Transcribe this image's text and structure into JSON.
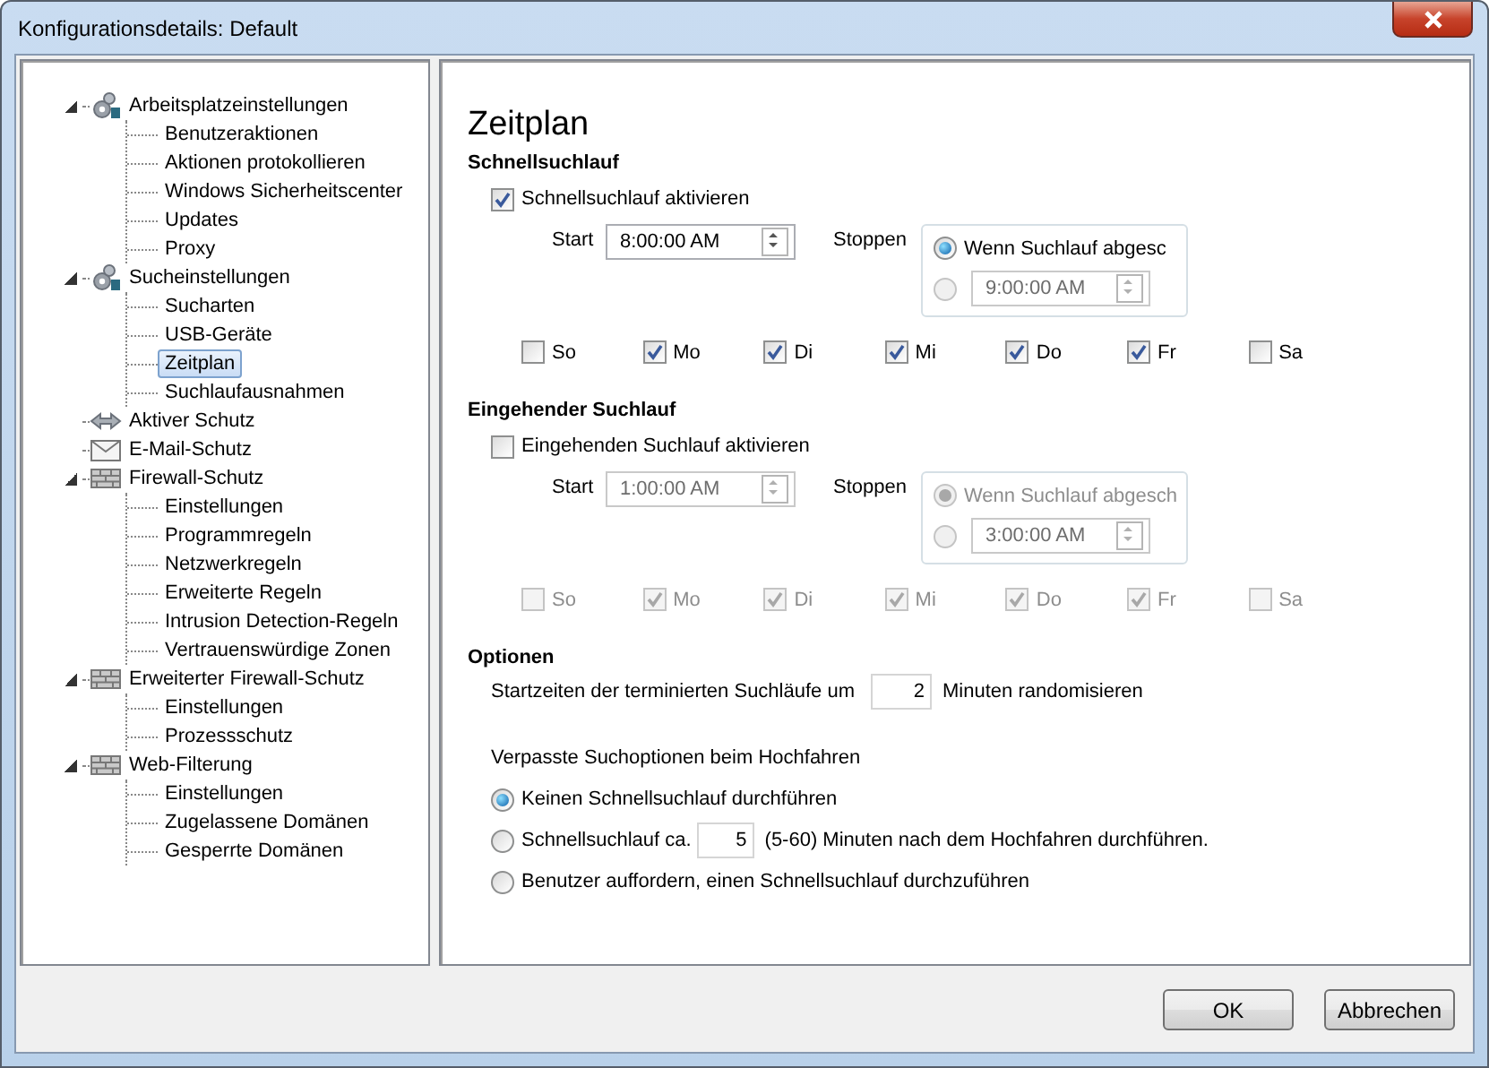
{
  "window": {
    "title": "Konfigurationsdetails: Default"
  },
  "tree": [
    {
      "label": "Arbeitsplatzeinstellungen",
      "kind": "gears",
      "expanded": true,
      "selected": false,
      "children": [
        {
          "label": "Benutzeraktionen",
          "selected": false
        },
        {
          "label": "Aktionen protokollieren",
          "selected": false
        },
        {
          "label": "Windows Sicherheitscenter",
          "selected": false
        },
        {
          "label": "Updates",
          "selected": false
        },
        {
          "label": "Proxy",
          "selected": false
        }
      ]
    },
    {
      "label": "Sucheinstellungen",
      "kind": "gears",
      "expanded": true,
      "selected": false,
      "children": [
        {
          "label": "Sucharten",
          "selected": false
        },
        {
          "label": "USB-Geräte",
          "selected": false
        },
        {
          "label": "Zeitplan",
          "selected": true
        },
        {
          "label": "Suchlaufausnahmen",
          "selected": false
        }
      ]
    },
    {
      "label": "Aktiver Schutz",
      "kind": "arrows",
      "expanded": false,
      "selected": false
    },
    {
      "label": "E-Mail-Schutz",
      "kind": "mail",
      "expanded": false,
      "selected": false
    },
    {
      "label": "Firewall-Schutz",
      "kind": "wall",
      "expanded": true,
      "selected": false,
      "children": [
        {
          "label": "Einstellungen",
          "selected": false
        },
        {
          "label": "Programmregeln",
          "selected": false
        },
        {
          "label": "Netzwerkregeln",
          "selected": false
        },
        {
          "label": "Erweiterte Regeln",
          "selected": false
        },
        {
          "label": "Intrusion Detection-Regeln",
          "selected": false
        },
        {
          "label": "Vertrauenswürdige Zonen",
          "selected": false
        }
      ]
    },
    {
      "label": "Erweiterter Firewall-Schutz",
      "kind": "wall",
      "expanded": true,
      "selected": false,
      "children": [
        {
          "label": "Einstellungen",
          "selected": false
        },
        {
          "label": "Prozessschutz",
          "selected": false
        }
      ]
    },
    {
      "label": "Web-Filterung",
      "kind": "wall",
      "expanded": true,
      "selected": false,
      "children": [
        {
          "label": "Einstellungen",
          "selected": false
        },
        {
          "label": "Zugelassene Domänen",
          "selected": false
        },
        {
          "label": "Gesperrte Domänen",
          "selected": false
        }
      ]
    }
  ],
  "page_title": "Zeitplan",
  "scans": [
    {
      "heading": "Schnellsuchlauf",
      "enable_label": "Schnellsuchlauf aktivieren",
      "enabled": true,
      "start_label": "Start",
      "start_time": "8:00:00 AM",
      "stop_label": "Stoppen",
      "stop_options": [
        {
          "kind": "label",
          "label": "Wenn Suchlauf abgesc",
          "selected": true
        },
        {
          "kind": "time",
          "value": "9:00:00 AM",
          "selected": false
        }
      ],
      "days": [
        {
          "label": "So",
          "checked": false
        },
        {
          "label": "Mo",
          "checked": true
        },
        {
          "label": "Di",
          "checked": true
        },
        {
          "label": "Mi",
          "checked": true
        },
        {
          "label": "Do",
          "checked": true
        },
        {
          "label": "Fr",
          "checked": true
        },
        {
          "label": "Sa",
          "checked": false
        }
      ]
    },
    {
      "heading": "Eingehender Suchlauf",
      "enable_label": "Eingehenden Suchlauf aktivieren",
      "enabled": false,
      "start_label": "Start",
      "start_time": "1:00:00 AM",
      "stop_label": "Stoppen",
      "stop_options": [
        {
          "kind": "label",
          "label": "Wenn Suchlauf abgesch",
          "selected": true
        },
        {
          "kind": "time",
          "value": "3:00:00 AM",
          "selected": false
        }
      ],
      "days": [
        {
          "label": "So",
          "checked": false
        },
        {
          "label": "Mo",
          "checked": true
        },
        {
          "label": "Di",
          "checked": true
        },
        {
          "label": "Mi",
          "checked": true
        },
        {
          "label": "Do",
          "checked": true
        },
        {
          "label": "Fr",
          "checked": true
        },
        {
          "label": "Sa",
          "checked": false
        }
      ]
    }
  ],
  "options": {
    "heading": "Optionen",
    "randomize_before": "Startzeiten der terminierten Suchläufe um",
    "randomize_value": "2",
    "randomize_after": "Minuten randomisieren",
    "missed_caption": "Verpasste Suchoptionen beim Hochfahren",
    "missed": [
      {
        "kind": "text",
        "label": "Keinen Schnellsuchlauf durchführen",
        "selected": true
      },
      {
        "kind": "minutes",
        "before": "Schnellsuchlauf ca.",
        "value": "5",
        "after": "(5-60) Minuten nach dem Hochfahren durchführen.",
        "selected": false
      },
      {
        "kind": "text",
        "label": "Benutzer auffordern, einen Schnellsuchlauf durchzuführen",
        "selected": false
      }
    ]
  },
  "buttons": [
    "OK",
    "Abbrechen"
  ]
}
